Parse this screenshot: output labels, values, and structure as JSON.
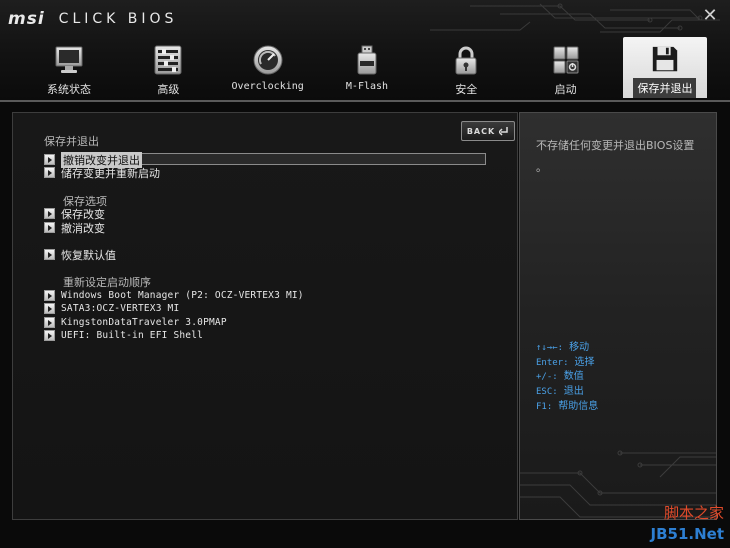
{
  "brand": {
    "logo": "msi",
    "subtitle": "CLICK BIOS"
  },
  "window": {
    "close_symbol": "✕"
  },
  "tabs": [
    {
      "label": "系统状态",
      "icon": "monitor-icon",
      "active": false
    },
    {
      "label": "高级",
      "icon": "sliders-icon",
      "active": false
    },
    {
      "label": "Overclocking",
      "icon": "gauge-icon",
      "active": false
    },
    {
      "label": "M-Flash",
      "icon": "usb-drive-icon",
      "active": false
    },
    {
      "label": "安全",
      "icon": "padlock-icon",
      "active": false
    },
    {
      "label": "启动",
      "icon": "power-switch-icon",
      "active": false
    },
    {
      "label": "保存并退出",
      "icon": "floppy-disk-icon",
      "active": true
    }
  ],
  "main": {
    "back_label": "BACK",
    "section_title": "保存并退出",
    "exit_items": [
      "撤销改变并退出",
      "储存变更并重新启动"
    ],
    "save_options_title": "保存选项",
    "save_items": [
      "保存改变",
      "撤消改变"
    ],
    "restore_default": "恢复默认值",
    "boot_override_title": "重新设定启动顺序",
    "boot_items": [
      "Windows Boot Manager (P2: OCZ-VERTEX3 MI)",
      "SATA3:OCZ-VERTEX3 MI",
      "KingstonDataTraveler 3.0PMAP",
      "UEFI: Built-in EFI Shell"
    ]
  },
  "help": {
    "description": "不存储任何变更并退出BIOS设置",
    "dot": "。",
    "keys": [
      {
        "key": "↑↓→←:",
        "desc": "移动"
      },
      {
        "key": "Enter:",
        "desc": "选择"
      },
      {
        "key": "+/-:",
        "desc": "数值"
      },
      {
        "key": "ESC:",
        "desc": "退出"
      },
      {
        "key": "F1:",
        "desc": "帮助信息"
      }
    ]
  },
  "watermark": {
    "top": "脚本之家",
    "bottom": "JB51.Net"
  },
  "colors": {
    "key_text": "#4aa0e6",
    "active_tab": "#e6e6e6",
    "watermark_red": "#e04a2a",
    "watermark_blue": "#2d7fd2"
  }
}
